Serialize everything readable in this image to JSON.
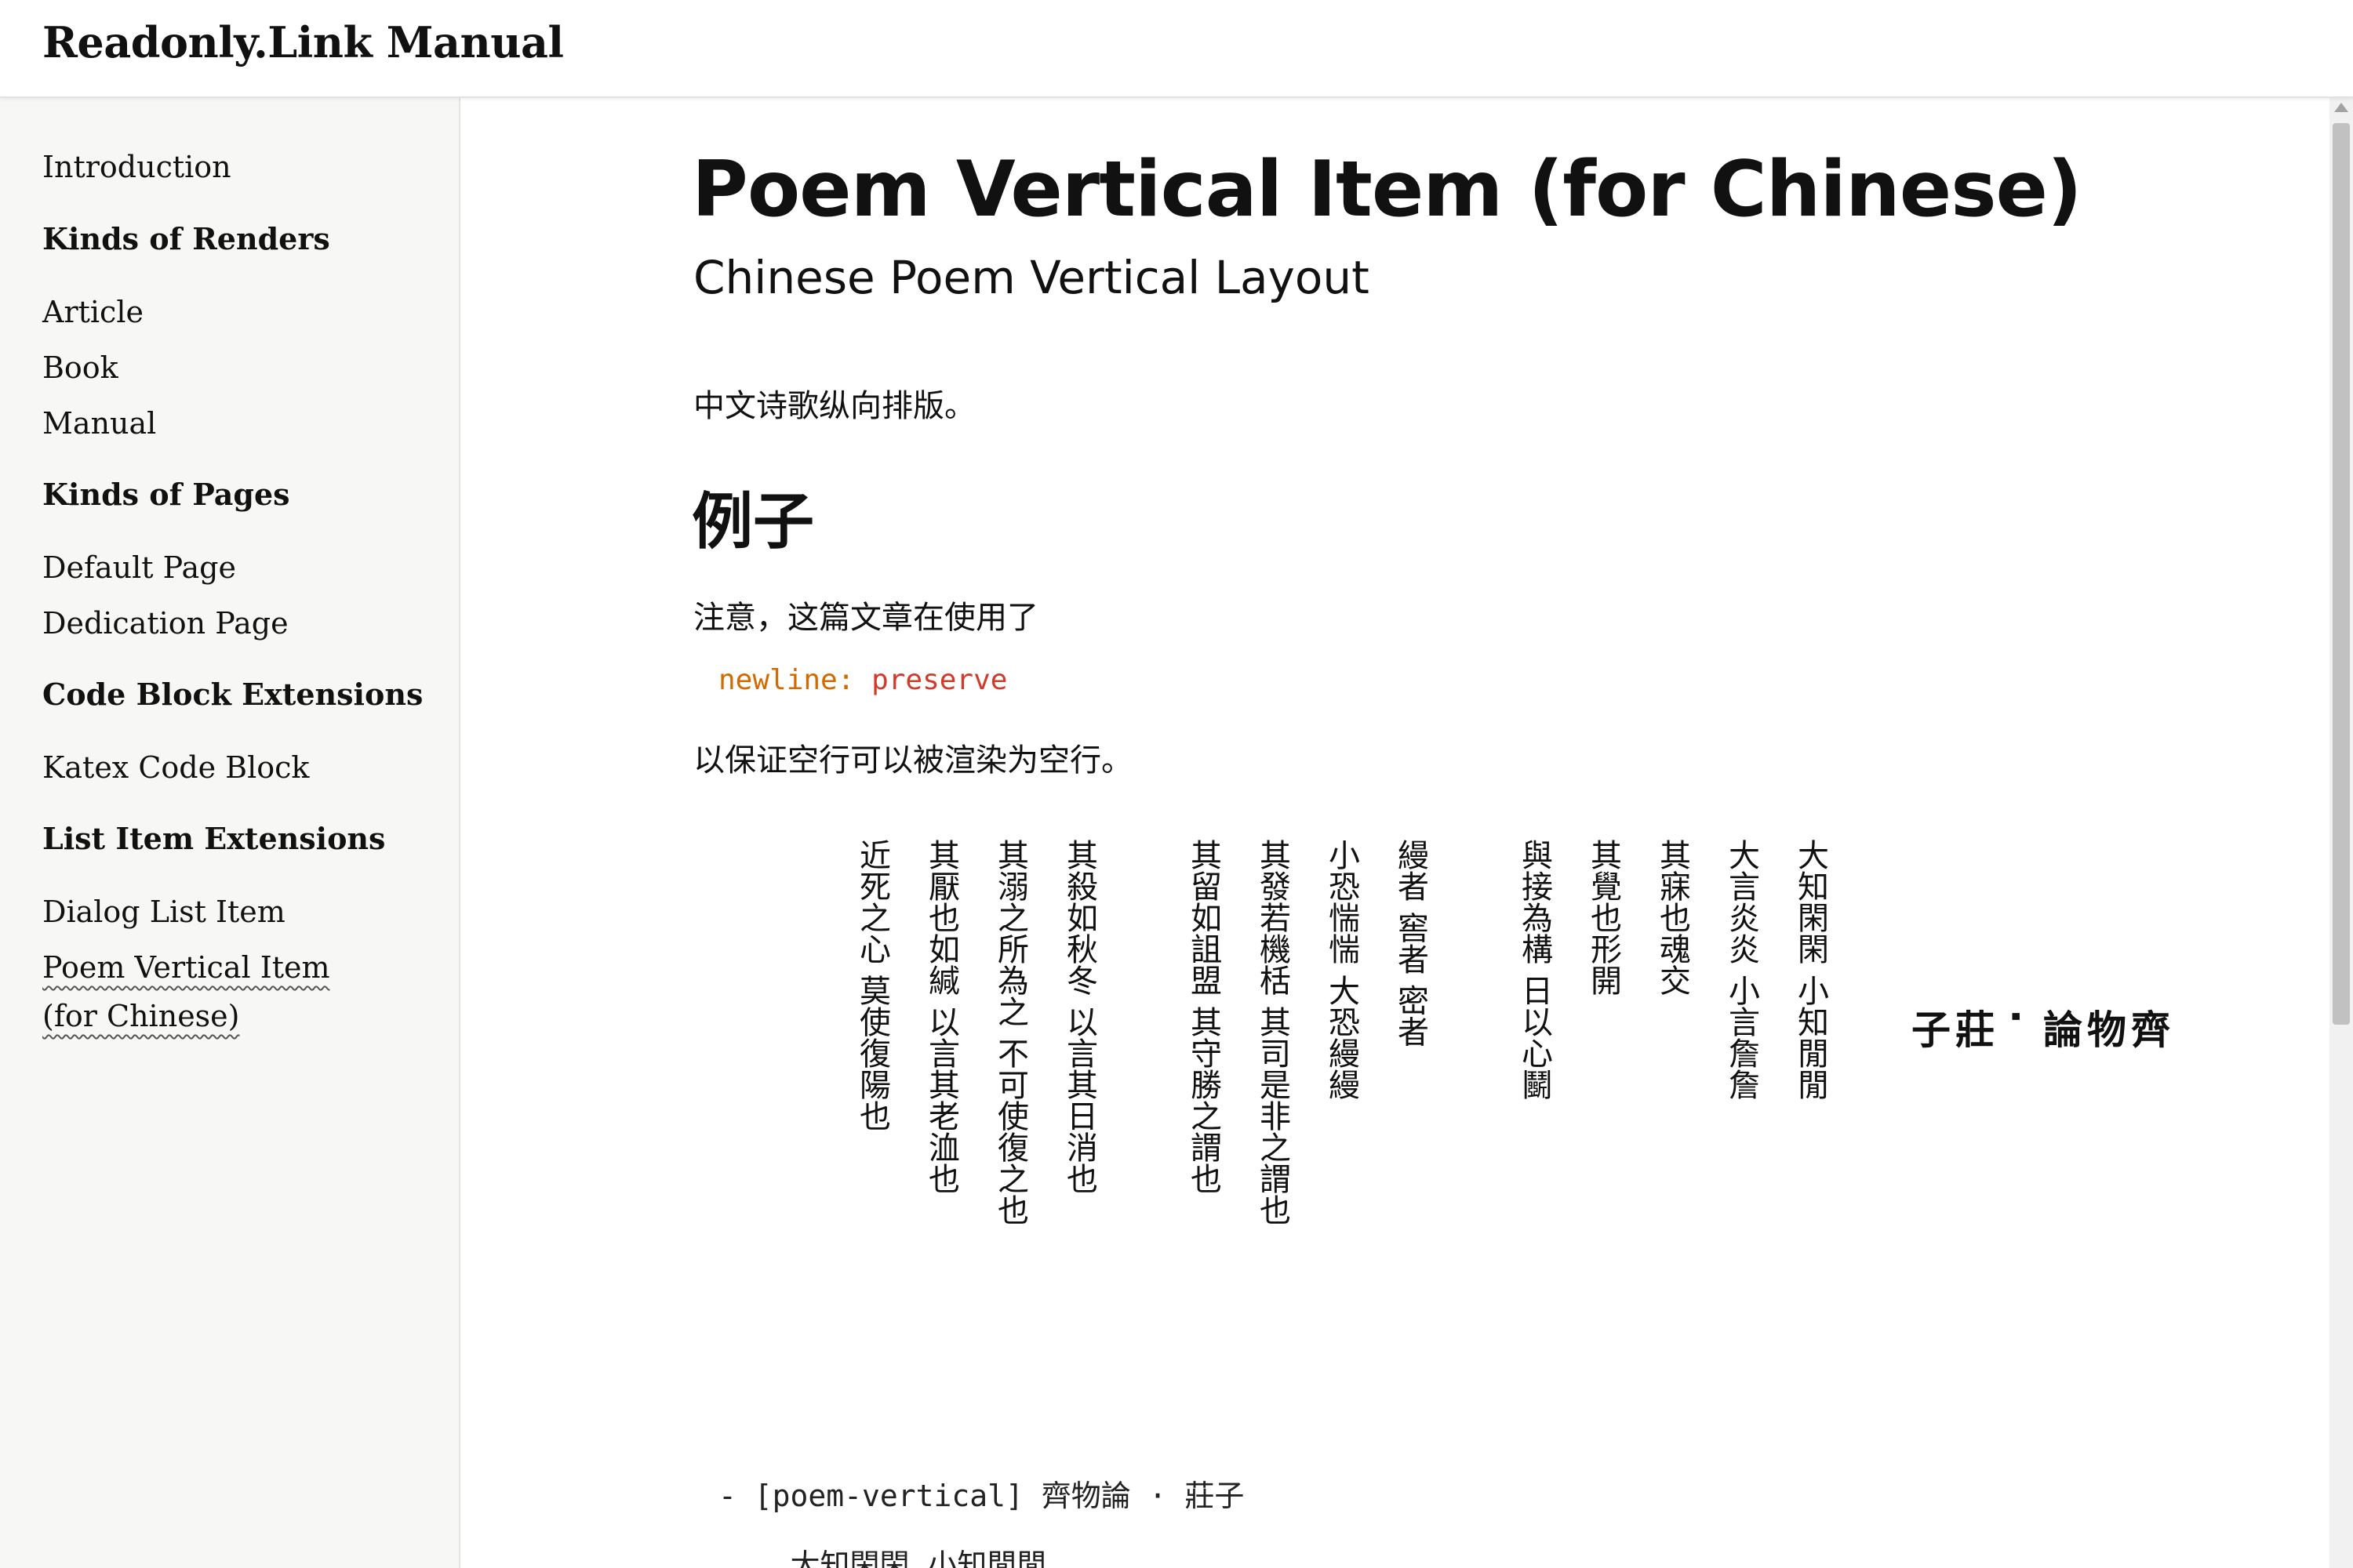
{
  "header": {
    "title": "Readonly.Link Manual"
  },
  "sidebar": {
    "introduction": "Introduction",
    "kinds_of_renders": "Kinds of Renders",
    "article": "Article",
    "book": "Book",
    "manual": "Manual",
    "kinds_of_pages": "Kinds of Pages",
    "default_page": "Default Page",
    "dedication_page": "Dedication Page",
    "code_block_extensions": "Code Block Extensions",
    "katex_code_block": "Katex Code Block",
    "list_item_extensions": "List Item Extensions",
    "dialog_list_item": "Dialog List Item",
    "poem_vertical_item": "Poem Vertical Item (for Chinese)"
  },
  "main": {
    "title": "Poem Vertical Item (for Chinese)",
    "subtitle": "Chinese Poem Vertical Layout",
    "intro": "中文诗歌纵向排版。",
    "example_heading": "例子",
    "note": "注意，这篇文章在使用了",
    "code_key": "newline:",
    "code_value": " preserve",
    "note2": "以保证空行可以被渲染为空行。",
    "poem": {
      "title": "齊物論·莊子",
      "lines": [
        "大知閑閑 小知閒閒",
        "大言炎炎 小言詹詹",
        "其寐也魂交",
        "其覺也形開",
        "與接為構 日以心鬭",
        "縵者 窖者 密者",
        "小恐惴惴 大恐縵縵",
        "其發若機栝 其司是非之謂也",
        "其留如詛盟 其守勝之謂也",
        "其殺如秋冬 以言其日消也",
        "其溺之所為之 不可使復之也",
        "其厭也如緘 以言其老洫也",
        "近死之心 莫使復陽也"
      ]
    },
    "code_block": {
      "line1": "- [poem-vertical] 齊物論 · 莊子",
      "line2": "    大知閑閑 小知閒閒"
    }
  }
}
